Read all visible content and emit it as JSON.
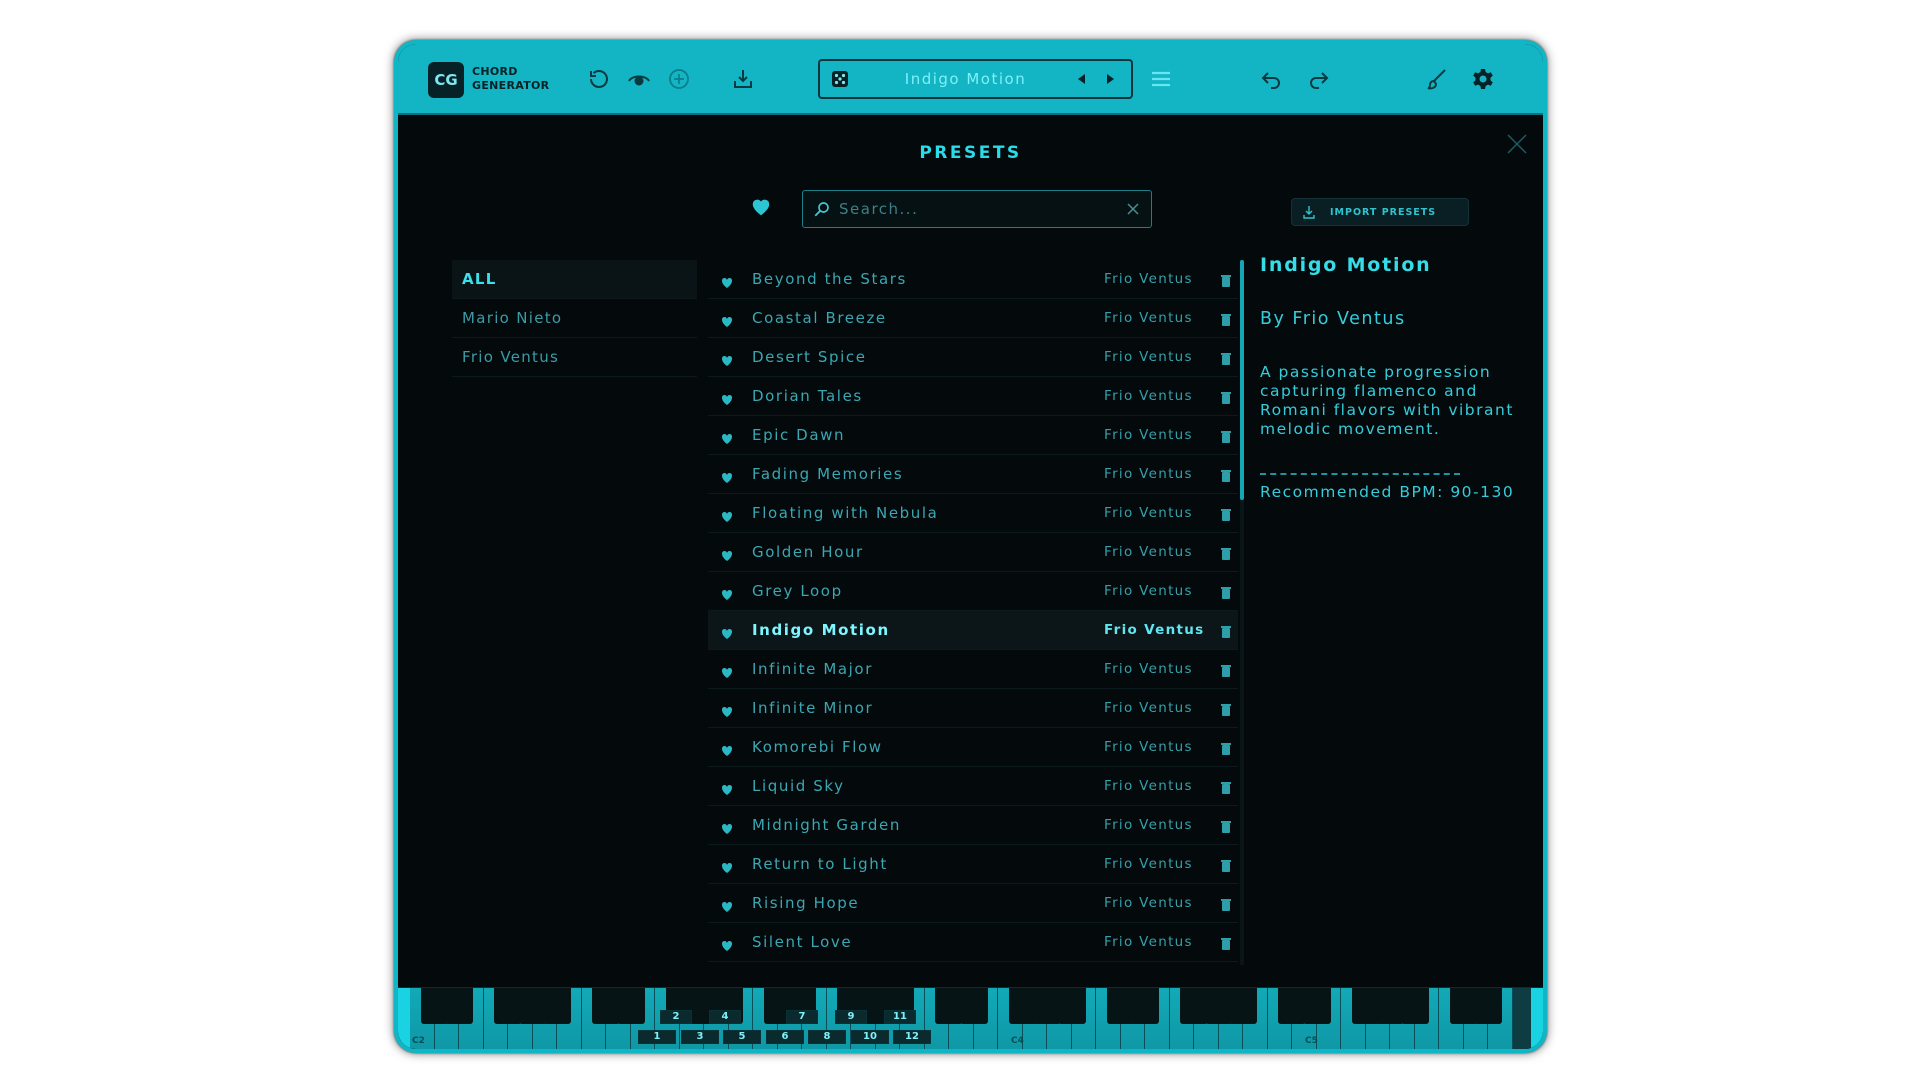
{
  "app": {
    "logo_short": "CG",
    "logo_line1": "CHORD",
    "logo_line2": "GENERATOR"
  },
  "toolbar": {
    "current_preset": "Indigo Motion",
    "icons": [
      "refresh-icon",
      "eye-icon",
      "target-icon",
      "save-icon",
      "dice-icon",
      "prev-arrow-icon",
      "next-arrow-icon",
      "menu-icon",
      "undo-icon",
      "redo-icon",
      "brush-icon",
      "gear-icon"
    ]
  },
  "presets_panel": {
    "title": "PRESETS",
    "search_placeholder": "Search...",
    "import_label": "IMPORT PRESETS",
    "authors": [
      {
        "label": "ALL",
        "active": true
      },
      {
        "label": "Mario Nieto",
        "active": false
      },
      {
        "label": "Frio Ventus",
        "active": false
      }
    ],
    "presets": [
      {
        "name": "Beyond the Stars",
        "author": "Frio Ventus"
      },
      {
        "name": "Coastal Breeze",
        "author": "Frio Ventus"
      },
      {
        "name": "Desert Spice",
        "author": "Frio Ventus"
      },
      {
        "name": "Dorian Tales",
        "author": "Frio Ventus"
      },
      {
        "name": "Epic Dawn",
        "author": "Frio Ventus"
      },
      {
        "name": "Fading Memories",
        "author": "Frio Ventus"
      },
      {
        "name": "Floating with Nebula",
        "author": "Frio Ventus"
      },
      {
        "name": "Golden Hour",
        "author": "Frio Ventus"
      },
      {
        "name": "Grey Loop",
        "author": "Frio Ventus"
      },
      {
        "name": "Indigo Motion",
        "author": "Frio Ventus",
        "selected": true
      },
      {
        "name": "Infinite Major",
        "author": "Frio Ventus"
      },
      {
        "name": "Infinite Minor",
        "author": "Frio Ventus"
      },
      {
        "name": "Komorebi Flow",
        "author": "Frio Ventus"
      },
      {
        "name": "Liquid Sky",
        "author": "Frio Ventus"
      },
      {
        "name": "Midnight Garden",
        "author": "Frio Ventus"
      },
      {
        "name": "Return to Light",
        "author": "Frio Ventus"
      },
      {
        "name": "Rising Hope",
        "author": "Frio Ventus"
      },
      {
        "name": "Silent Love",
        "author": "Frio Ventus"
      }
    ],
    "detail": {
      "title": "Indigo Motion",
      "by": "By Frio Ventus",
      "description": "A passionate progression capturing flamenco and Romani flavors with vibrant melodic movement.",
      "bpm": "Recommended BPM: 90-130"
    }
  },
  "keyboard": {
    "upper_numbers": [
      "2",
      "4",
      "7",
      "9",
      "11"
    ],
    "lower_numbers": [
      "1",
      "3",
      "5",
      "6",
      "8",
      "10",
      "12"
    ],
    "octave_labels": [
      "C2",
      "C4",
      "C5"
    ]
  },
  "colors": {
    "accent": "#13b4c4",
    "background": "#04090b",
    "text_primary": "#35dde9"
  }
}
